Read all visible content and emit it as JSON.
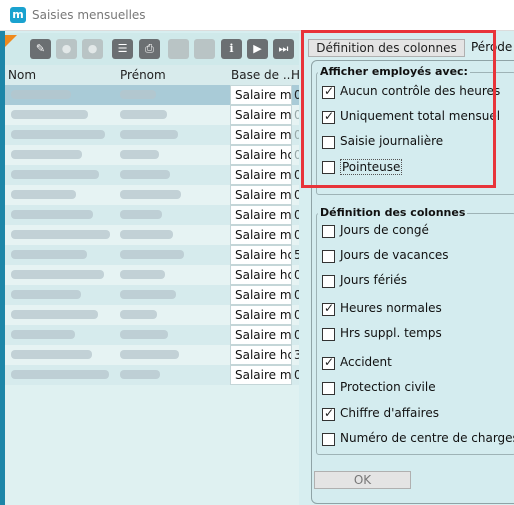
{
  "window": {
    "title": "Saisies mensuelles",
    "app_icon": "m"
  },
  "toolbar": {
    "icons": [
      "pencil-icon",
      "check-circle-icon",
      "cancel-circle-icon",
      "list-icon",
      "print-icon",
      "blank-icon",
      "blank-icon",
      "info-icon",
      "play-icon",
      "skip-end-icon"
    ]
  },
  "table": {
    "headers": {
      "nom": "Nom",
      "prenom": "Prénom",
      "base": "Base de ...",
      "h": "H"
    },
    "rows": [
      {
        "base": "Salaire m",
        "h": "0",
        "dim": false
      },
      {
        "base": "Salaire m",
        "h": "0",
        "dim": true
      },
      {
        "base": "Salaire m",
        "h": "0",
        "dim": true
      },
      {
        "base": "Salaire ho",
        "h": "0",
        "dim": true
      },
      {
        "base": "Salaire m",
        "h": "0",
        "dim": false
      },
      {
        "base": "Salaire m",
        "h": "0.0",
        "dim": false
      },
      {
        "base": "Salaire m",
        "h": "0.0",
        "dim": false
      },
      {
        "base": "Salaire m",
        "h": "0.0",
        "dim": false
      },
      {
        "base": "Salaire ho",
        "h": "59.",
        "dim": false
      },
      {
        "base": "Salaire ho",
        "h": "0.0",
        "dim": false
      },
      {
        "base": "Salaire m",
        "h": "0.0",
        "dim": false
      },
      {
        "base": "Salaire m",
        "h": "0.0",
        "dim": false
      },
      {
        "base": "Salaire m",
        "h": "0.0",
        "dim": false
      },
      {
        "base": "Salaire ho",
        "h": "30.",
        "dim": false
      },
      {
        "base": "Salaire m",
        "h": "0.0",
        "dim": false
      }
    ]
  },
  "def_colonnes_button": "Définition des colonnes",
  "periode_label": "Pérode",
  "panel": {
    "group1_title": "Afficher employés avec:",
    "group1_options": [
      {
        "label": "Aucun contrôle des heures",
        "checked": true
      },
      {
        "label": "Uniquement total mensuel",
        "checked": true
      },
      {
        "label": "Saisie journalière",
        "checked": false
      },
      {
        "label": "Pointeuse",
        "checked": false
      }
    ],
    "group2_title": "Définition des colonnes",
    "group2_options": [
      {
        "label": "Jours de congé",
        "checked": false
      },
      {
        "label": "Jours de vacances",
        "checked": false
      },
      {
        "label": "Jours fériés",
        "checked": false
      },
      {
        "label": "Heures normales",
        "checked": true
      },
      {
        "label": "Hrs suppl. temps",
        "checked": false
      },
      {
        "label": "Accident",
        "checked": true
      },
      {
        "label": "Protection civile",
        "checked": false
      },
      {
        "label": "Chiffre d'affaires",
        "checked": true
      },
      {
        "label": "Numéro de centre de charges",
        "checked": false
      }
    ],
    "ok_label": "OK"
  },
  "accent_colors": {
    "highlight": "#e8343a",
    "brand": "#1aa2cf"
  }
}
